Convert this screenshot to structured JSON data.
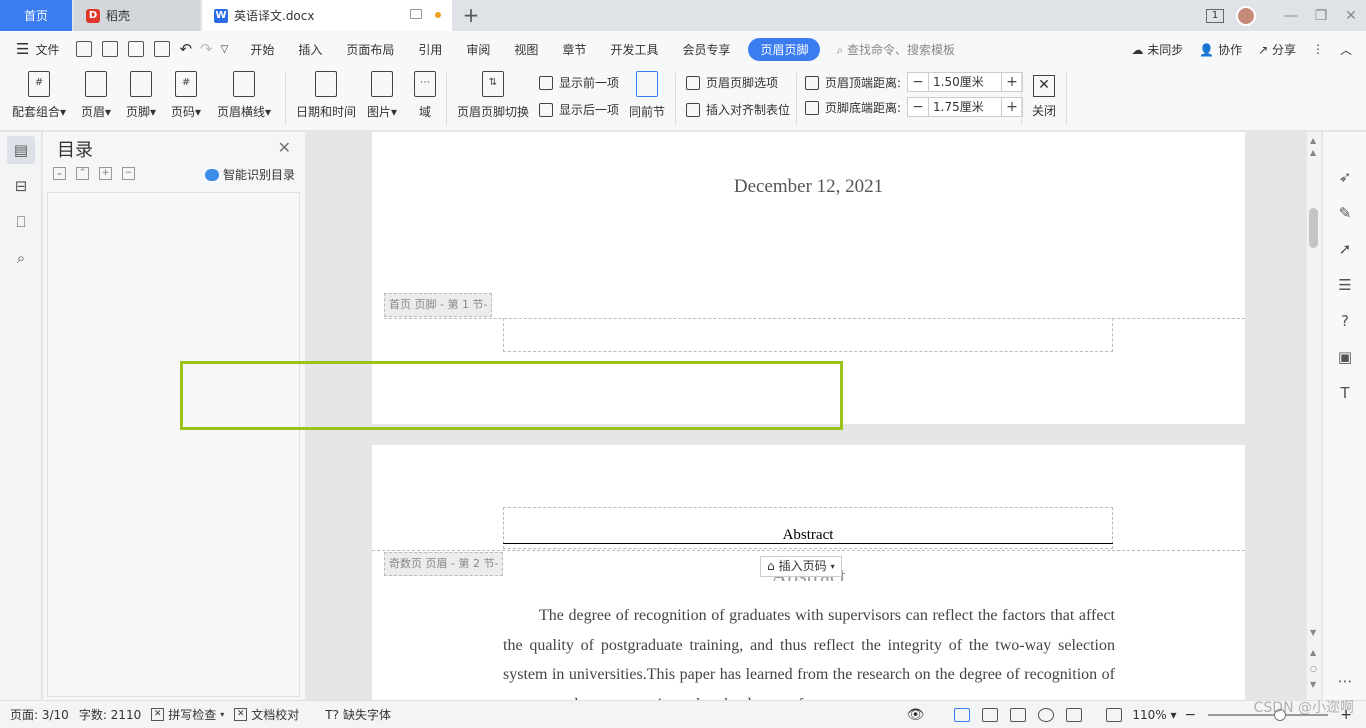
{
  "tabs": {
    "home": "首页",
    "daoke": "稻壳",
    "doc": "英语译文.docx",
    "daoke_logo": "D",
    "doc_logo": "W"
  },
  "menu": {
    "file": "文件",
    "items": [
      "开始",
      "插入",
      "页面布局",
      "引用",
      "审阅",
      "视图",
      "章节",
      "开发工具",
      "会员专享"
    ],
    "active": "页眉页脚",
    "search": "查找命令、搜索模板",
    "unsynced": "未同步",
    "collab": "协作",
    "share": "分享"
  },
  "ribbon": {
    "combo": "配套组合",
    "header": "页眉",
    "footer": "页脚",
    "pagenum": "页码",
    "header_line": "页眉横线",
    "datetime": "日期和时间",
    "picture": "图片",
    "field": "域",
    "switch": "页眉页脚切换",
    "prev": "显示前一项",
    "next": "显示后一项",
    "same_prev": "同前节",
    "options": "页眉页脚选项",
    "align_tab": "插入对齐制表位",
    "top_dist_label": "页眉顶端距离:",
    "top_dist": "1.50厘米",
    "bottom_dist_label": "页脚底端距离:",
    "bottom_dist": "1.75厘米",
    "close": "关闭"
  },
  "toc": {
    "title": "目录",
    "smart": "智能识别目录"
  },
  "document": {
    "date": "December 12, 2021",
    "footer_label_1": "首页 页脚 - 第 1 节-",
    "header_label_2": "奇数页 页眉 - 第 2 节-",
    "header_text": "Abstract",
    "ghost_title": "Abstract",
    "insert_page_num": "插入页码",
    "body": "The degree of recognition of graduates with supervisors can reflect the factors that affect the quality of postgraduate training, and thus reflect the integrity of the two-way selection system in universities.This paper has learned from the research on the degree of recognition of master graduates supervisors that the degree of"
  },
  "status": {
    "page": "页面: 3/10",
    "words": "字数: 2110",
    "spell": "拼写检查",
    "proof": "文档校对",
    "missing_font": "缺失字体",
    "zoom": "110%",
    "watermark": "CSDN @小迩啊"
  },
  "colors": {
    "accent": "#3b7cf0",
    "highlight_box": "#9ac31c"
  }
}
